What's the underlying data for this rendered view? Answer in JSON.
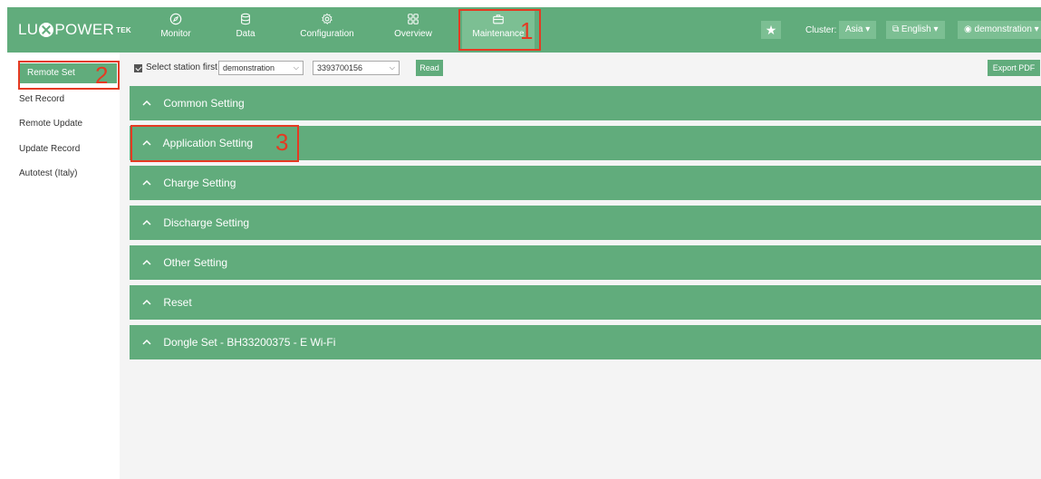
{
  "brand": {
    "name_part1": "LU",
    "name_part2": "POWER",
    "tm": "TEK"
  },
  "nav": {
    "items": [
      {
        "label": "Monitor",
        "icon": "compass-icon"
      },
      {
        "label": "Data",
        "icon": "database-icon"
      },
      {
        "label": "Configuration",
        "icon": "gear-icon"
      },
      {
        "label": "Overview",
        "icon": "grid-icon"
      },
      {
        "label": "Maintenance",
        "icon": "toolbox-icon",
        "active": true
      }
    ],
    "cluster_label": "Cluster:",
    "cluster_value": "Asia",
    "language": "English",
    "user": "demonstration"
  },
  "annotations": {
    "one": "1",
    "two": "2",
    "three": "3"
  },
  "sidebar": {
    "items": [
      {
        "label": "Remote Set",
        "active": true
      },
      {
        "label": "Set Record"
      },
      {
        "label": "Remote Update"
      },
      {
        "label": "Update Record"
      },
      {
        "label": "Autotest (Italy)"
      }
    ]
  },
  "toolbar": {
    "checkbox_label": "Select station first",
    "station_value": "demonstration",
    "serial_value": "3393700156",
    "read_label": "Read",
    "export_label": "Export PDF"
  },
  "sections": [
    "Common Setting",
    "Application Setting",
    "Charge Setting",
    "Discharge Setting",
    "Other Setting",
    "Reset",
    "Dongle Set - BH33200375 - E Wi-Fi"
  ],
  "colors": {
    "brand_green": "#61ac7c",
    "highlight_green": "#7cbf93",
    "annotation_red": "#e53a22"
  }
}
